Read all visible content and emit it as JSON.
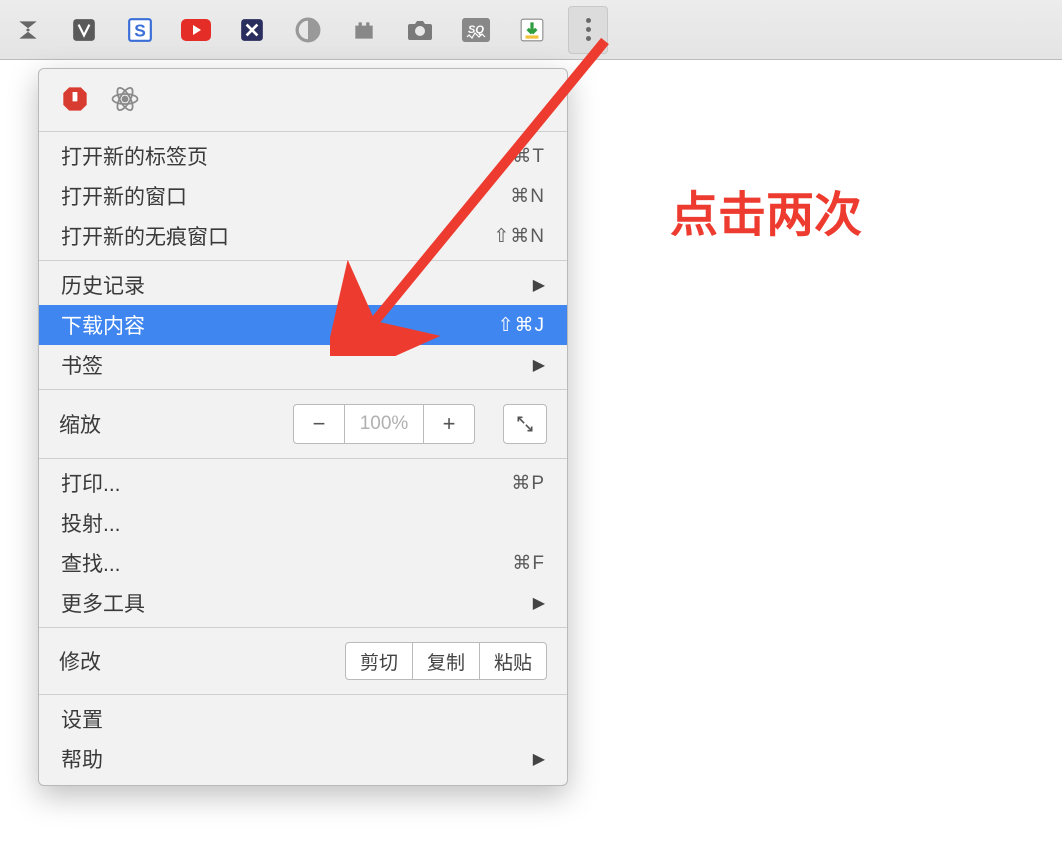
{
  "toolbar": {
    "extensions": [
      {
        "name": "zumo-icon"
      },
      {
        "name": "vimium-icon"
      },
      {
        "name": "s-icon"
      },
      {
        "name": "youtube-icon"
      },
      {
        "name": "x-icon"
      },
      {
        "name": "simplenote-icon"
      },
      {
        "name": "castle-icon"
      },
      {
        "name": "camera-icon"
      },
      {
        "name": "sq-icon"
      },
      {
        "name": "download-icon"
      }
    ]
  },
  "menu": {
    "new_tab": {
      "label": "打开新的标签页",
      "shortcut": "⌘T"
    },
    "new_window": {
      "label": "打开新的窗口",
      "shortcut": "⌘N"
    },
    "incognito": {
      "label": "打开新的无痕窗口",
      "shortcut": "⇧⌘N"
    },
    "history": {
      "label": "历史记录"
    },
    "downloads": {
      "label": "下载内容",
      "shortcut": "⇧⌘J"
    },
    "bookmarks": {
      "label": "书签"
    },
    "zoom": {
      "label": "缩放",
      "value": "100%"
    },
    "print": {
      "label": "打印...",
      "shortcut": "⌘P"
    },
    "cast": {
      "label": "投射..."
    },
    "find": {
      "label": "查找...",
      "shortcut": "⌘F"
    },
    "more_tools": {
      "label": "更多工具"
    },
    "edit": {
      "label": "修改",
      "cut": "剪切",
      "copy": "复制",
      "paste": "粘贴"
    },
    "settings": {
      "label": "设置"
    },
    "help": {
      "label": "帮助"
    }
  },
  "annotation": {
    "text": "点击两次"
  }
}
